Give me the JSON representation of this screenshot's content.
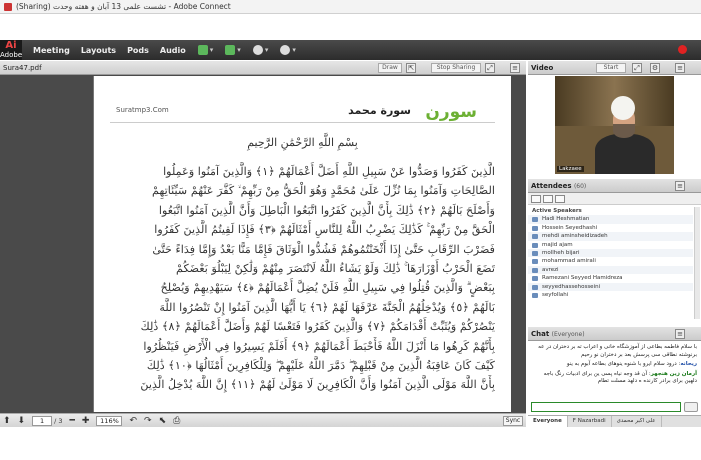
{
  "window": {
    "title": "(Sharing) تشست علمی 13 آبان و هفته وحدت - Adobe Connect"
  },
  "menubar": {
    "logo_top": "Ai",
    "logo_bottom": "Adobe",
    "items": [
      "Meeting",
      "Layouts",
      "Pods",
      "Audio"
    ]
  },
  "share_pod": {
    "file_name": "Sura47.pdf",
    "draw_label": "Draw",
    "stop_sharing_label": "Stop Sharing"
  },
  "document": {
    "site_url": "Suratmp3.Com",
    "surah_title": "سورة محمد",
    "brand": "سورن",
    "bismillah": "بِسْمِ اللَّهِ الرَّحْمَٰنِ الرَّحِيمِ",
    "verse_lines": [
      "الَّذِينَ كَفَرُوا وَصَدُّوا عَنْ سَبِيلِ اللَّهِ أَضَلَّ أَعْمَالَهُمْ ﴿١﴾ وَالَّذِينَ آمَنُوا وَعَمِلُوا",
      "الصَّالِحَاتِ وَآمَنُوا بِمَا نُزِّلَ عَلَىٰ مُحَمَّدٍ وَهُوَ الْحَقُّ مِنْ رَبِّهِمْ ۙ كَفَّرَ عَنْهُمْ سَيِّئَاتِهِمْ",
      "وَأَصْلَحَ بَالَهُمْ ﴿٢﴾ ذَٰلِكَ بِأَنَّ الَّذِينَ كَفَرُوا اتَّبَعُوا الْبَاطِلَ وَأَنَّ الَّذِينَ آمَنُوا اتَّبَعُوا",
      "الْحَقَّ مِنْ رَبِّهِمْ ۚ كَذَٰلِكَ يَضْرِبُ اللَّهُ لِلنَّاسِ أَمْثَالَهُمْ ﴿٣﴾ فَإِذَا لَقِيتُمُ الَّذِينَ كَفَرُوا",
      "فَضَرْبَ الرِّقَابِ حَتَّىٰ إِذَا أَثْخَنْتُمُوهُمْ فَشُدُّوا الْوَثَاقَ فَإِمَّا مَنًّا بَعْدُ وَإِمَّا فِدَاءً حَتَّىٰ",
      "تَضَعَ الْحَرْبُ أَوْزَارَهَا ۚ ذَٰلِكَ وَلَوْ يَشَاءُ اللَّهُ لَانْتَصَرَ مِنْهُمْ وَلَٰكِنْ لِيَبْلُوَ بَعْضَكُمْ",
      "بِبَعْضٍ ۗ وَالَّذِينَ قُتِلُوا فِي سَبِيلِ اللَّهِ فَلَنْ يُضِلَّ أَعْمَالَهُمْ ﴿٤﴾ سَيَهْدِيهِمْ وَيُصْلِحُ",
      "بَالَهُمْ ﴿٥﴾ وَيُدْخِلُهُمُ الْجَنَّةَ عَرَّفَهَا لَهُمْ ﴿٦﴾ يَا أَيُّهَا الَّذِينَ آمَنُوا إِنْ تَنْصُرُوا اللَّهَ",
      "يَنْصُرْكُمْ وَيُثَبِّتْ أَقْدَامَكُمْ ﴿٧﴾ وَالَّذِينَ كَفَرُوا فَتَعْسًا لَهُمْ وَأَضَلَّ أَعْمَالَهُمْ ﴿٨﴾ ذَٰلِكَ",
      "بِأَنَّهُمْ كَرِهُوا مَا أَنْزَلَ اللَّهُ فَأَحْبَطَ أَعْمَالَهُمْ ﴿٩﴾ أَفَلَمْ يَسِيرُوا فِي الْأَرْضِ فَيَنْظُرُوا",
      "كَيْفَ كَانَ عَاقِبَةُ الَّذِينَ مِنْ قَبْلِهِمْ ۖ دَمَّرَ اللَّهُ عَلَيْهِمْ ۖ وَلِلْكَافِرِينَ أَمْثَالُهَا ﴿١٠﴾ ذَٰلِكَ",
      "بِأَنَّ اللَّهَ مَوْلَى الَّذِينَ آمَنُوا وَأَنَّ الْكَافِرِينَ لَا مَوْلَىٰ لَهُمْ ﴿١١﴾ إِنَّ اللَّهَ يُدْخِلُ الَّذِينَ"
    ]
  },
  "doc_toolbar": {
    "page_value": "1",
    "page_total": "/ 3",
    "zoom_value": "116%",
    "sync_label": "Sync"
  },
  "video_pod": {
    "title": "Video",
    "start_label": "Start",
    "presenter_name": "Lakzaee"
  },
  "attendees_pod": {
    "title": "Attendees",
    "count": "(60)",
    "group_label": "Active Speakers",
    "names": [
      "Hadi Heshmatian",
      "Hossein Seyedhashi",
      "mehdi aminsheidizadeh",
      "majid ajam",
      "mollheh bijari",
      "mohammad amirali",
      "avrezi",
      "Ramezani Seyyed Hamidreza",
      "seyyedhassehosseini",
      "seyfollahi"
    ]
  },
  "chat_pod": {
    "title": "Chat",
    "scope": "(Everyone)",
    "messages": [
      {
        "name": "",
        "text": "با سلام فاطمه بطاعی از آموزشگاه خانی و اعراب ته بر دختران در عه برنوشته نطاقی سی پرسش بعد بر دختران نو رحیم"
      },
      {
        "name": "ریحانه",
        "text": "درود سلام ایرو با شنوه ینوهای بطاعه آبوم به ینو"
      },
      {
        "name": "آرمان زین هنجهر",
        "text": "آن قد وجه نیاه پسی ین برای ادبیات رنگ باجه دلهین برای برادر کارنده ه دلهد مسلت تطام"
      }
    ],
    "tabs": [
      "Everyone",
      "F Nazarbadi",
      "علی اکبر محمدی"
    ]
  }
}
